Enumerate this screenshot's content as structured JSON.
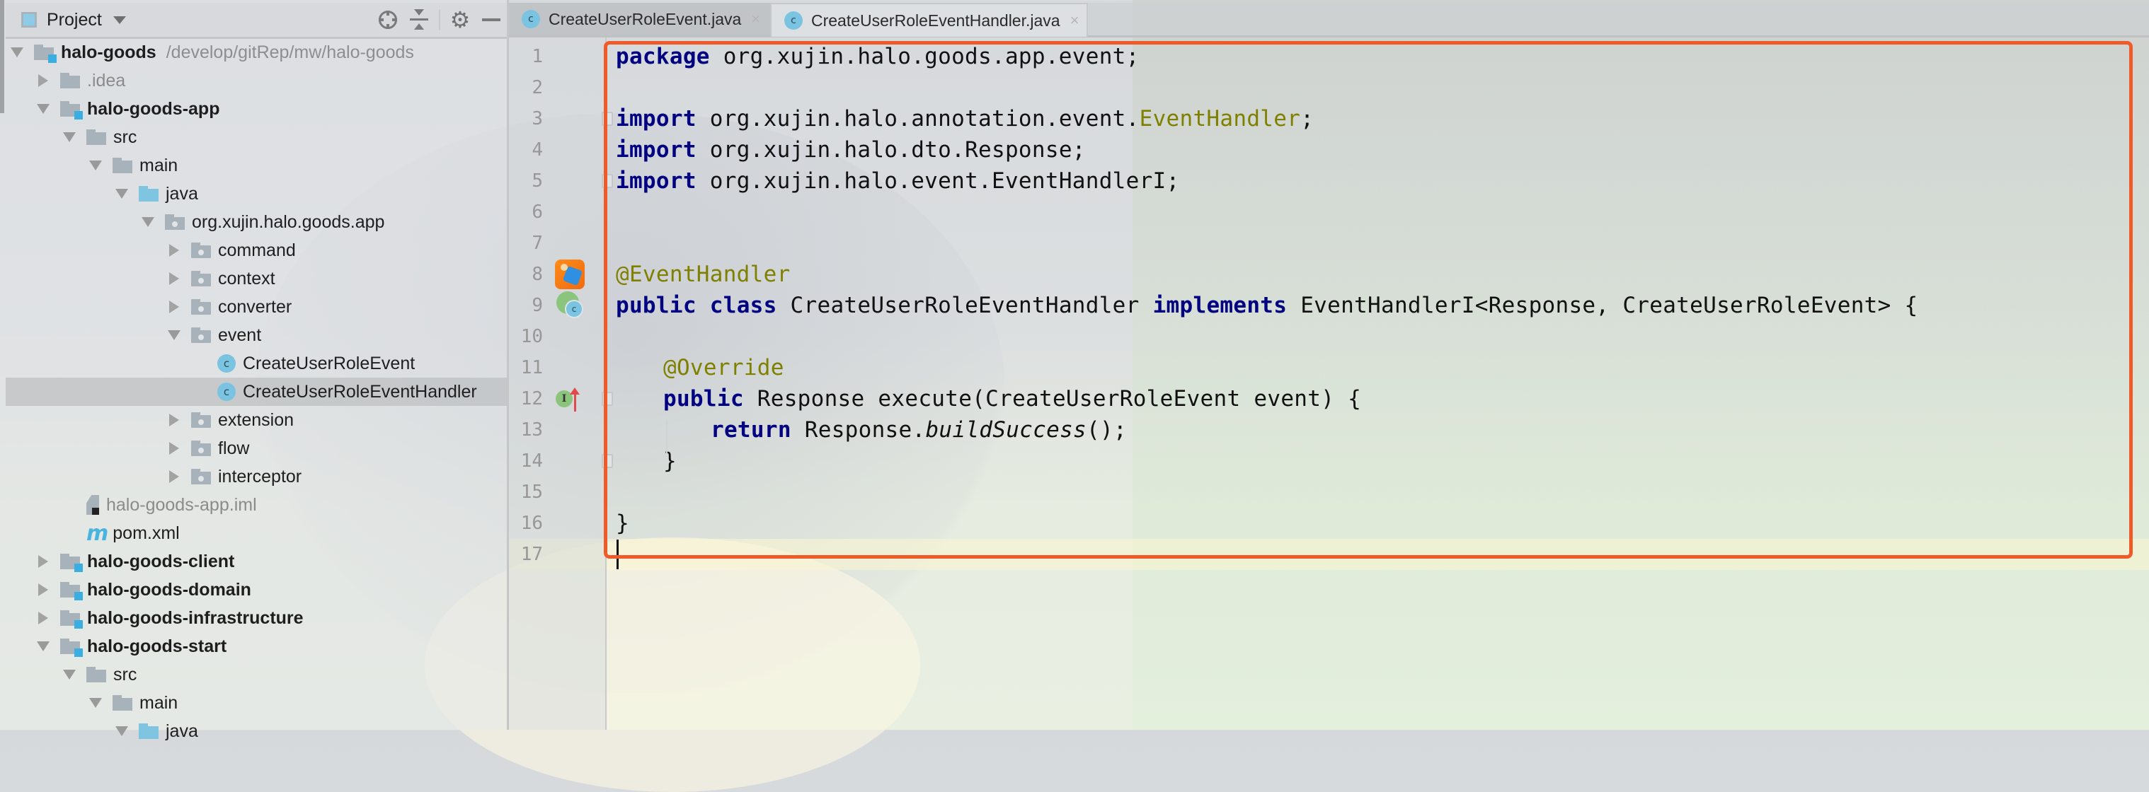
{
  "project_panel": {
    "title": "Project",
    "header_icons": [
      "locate-icon",
      "collapse-all-icon",
      "gear-icon",
      "minimize-icon"
    ],
    "tree": [
      {
        "label": "halo-goods",
        "path": "/develop/gitRep/mw/halo-goods",
        "type": "module",
        "depth": 0,
        "expanded": true,
        "bold": true
      },
      {
        "label": ".idea",
        "type": "folder",
        "depth": 1,
        "expanded": false,
        "muted": true
      },
      {
        "label": "halo-goods-app",
        "type": "module",
        "depth": 1,
        "expanded": true,
        "bold": true
      },
      {
        "label": "src",
        "type": "folder",
        "depth": 2,
        "expanded": true
      },
      {
        "label": "main",
        "type": "folder",
        "depth": 3,
        "expanded": true
      },
      {
        "label": "java",
        "type": "source-folder",
        "depth": 4,
        "expanded": true
      },
      {
        "label": "org.xujin.halo.goods.app",
        "type": "package",
        "depth": 5,
        "expanded": true
      },
      {
        "label": "command",
        "type": "package",
        "depth": 6,
        "expanded": false
      },
      {
        "label": "context",
        "type": "package",
        "depth": 6,
        "expanded": false
      },
      {
        "label": "converter",
        "type": "package",
        "depth": 6,
        "expanded": false
      },
      {
        "label": "event",
        "type": "package",
        "depth": 6,
        "expanded": true
      },
      {
        "label": "CreateUserRoleEvent",
        "type": "class",
        "depth": 7
      },
      {
        "label": "CreateUserRoleEventHandler",
        "type": "class",
        "depth": 7,
        "selected": true
      },
      {
        "label": "extension",
        "type": "package",
        "depth": 6,
        "expanded": false
      },
      {
        "label": "flow",
        "type": "package",
        "depth": 6,
        "expanded": false
      },
      {
        "label": "interceptor",
        "type": "package",
        "depth": 6,
        "expanded": false
      },
      {
        "label": "halo-goods-app.iml",
        "type": "iml",
        "depth": 2,
        "muted": true
      },
      {
        "label": "pom.xml",
        "type": "maven",
        "depth": 2
      },
      {
        "label": "halo-goods-client",
        "type": "module",
        "depth": 1,
        "expanded": false,
        "bold": true
      },
      {
        "label": "halo-goods-domain",
        "type": "module",
        "depth": 1,
        "expanded": false,
        "bold": true
      },
      {
        "label": "halo-goods-infrastructure",
        "type": "module",
        "depth": 1,
        "expanded": false,
        "bold": true
      },
      {
        "label": "halo-goods-start",
        "type": "module",
        "depth": 1,
        "expanded": true,
        "bold": true
      },
      {
        "label": "src",
        "type": "folder",
        "depth": 2,
        "expanded": true
      },
      {
        "label": "main",
        "type": "folder",
        "depth": 3,
        "expanded": true
      },
      {
        "label": "java",
        "type": "source-folder",
        "depth": 4,
        "expanded": true
      }
    ]
  },
  "tabs": [
    {
      "label": "CreateUserRoleEvent.java",
      "icon": "class-icon",
      "active": false,
      "close": "×"
    },
    {
      "label": "CreateUserRoleEventHandler.java",
      "icon": "class-icon",
      "active": true,
      "close": "×"
    }
  ],
  "editor": {
    "current_line": 17,
    "colors": {
      "keyword": "#000080",
      "annotation": "#808000",
      "highlight_box": "#f05a28"
    },
    "lines": [
      {
        "n": "1",
        "tokens": [
          [
            "kw",
            "package"
          ],
          [
            "",
            "org.xujin.halo.goods.app.event;"
          ]
        ]
      },
      {
        "n": "2",
        "tokens": []
      },
      {
        "n": "3",
        "tokens": [
          [
            "kw",
            "import"
          ],
          [
            "",
            "org.xujin.halo.annotation.event."
          ],
          [
            "ann",
            "EventHandler"
          ],
          [
            "",
            ";"
          ]
        ]
      },
      {
        "n": "4",
        "tokens": [
          [
            "kw",
            "import"
          ],
          [
            "",
            "org.xujin.halo.dto.Response;"
          ]
        ]
      },
      {
        "n": "5",
        "tokens": [
          [
            "kw",
            "import"
          ],
          [
            "",
            "org.xujin.halo.event.EventHandlerI;"
          ]
        ]
      },
      {
        "n": "6",
        "tokens": []
      },
      {
        "n": "7",
        "tokens": []
      },
      {
        "n": "8",
        "tokens": [
          [
            "ann",
            "@EventHandler"
          ]
        ],
        "gutter_icon": "spring-bean-icon"
      },
      {
        "n": "9",
        "tokens": [
          [
            "kw",
            "public"
          ],
          [
            "kw",
            "class"
          ],
          [
            "",
            "CreateUserRoleEventHandler"
          ],
          [
            "kw",
            "implements"
          ],
          [
            "",
            "EventHandlerI<Response, CreateUserRoleEvent> {"
          ]
        ],
        "gutter_icon": "implements-class-icon"
      },
      {
        "n": "10",
        "tokens": []
      },
      {
        "n": "11",
        "indent": 1,
        "tokens": [
          [
            "ann",
            "@Override"
          ]
        ]
      },
      {
        "n": "12",
        "indent": 1,
        "tokens": [
          [
            "kw",
            "public"
          ],
          [
            "",
            "Response execute(CreateUserRoleEvent event) {"
          ]
        ],
        "gutter_icon": "implements-method-icon"
      },
      {
        "n": "13",
        "indent": 2,
        "tokens": [
          [
            "kw",
            "return"
          ],
          [
            "",
            "Response."
          ],
          [
            "ital",
            "buildSuccess"
          ],
          [
            "",
            "();"
          ]
        ]
      },
      {
        "n": "14",
        "indent": 1,
        "tokens": [
          [
            "",
            "}"
          ]
        ]
      },
      {
        "n": "15",
        "tokens": []
      },
      {
        "n": "16",
        "tokens": [
          [
            "",
            "}"
          ]
        ]
      },
      {
        "n": "17",
        "tokens": []
      }
    ]
  }
}
